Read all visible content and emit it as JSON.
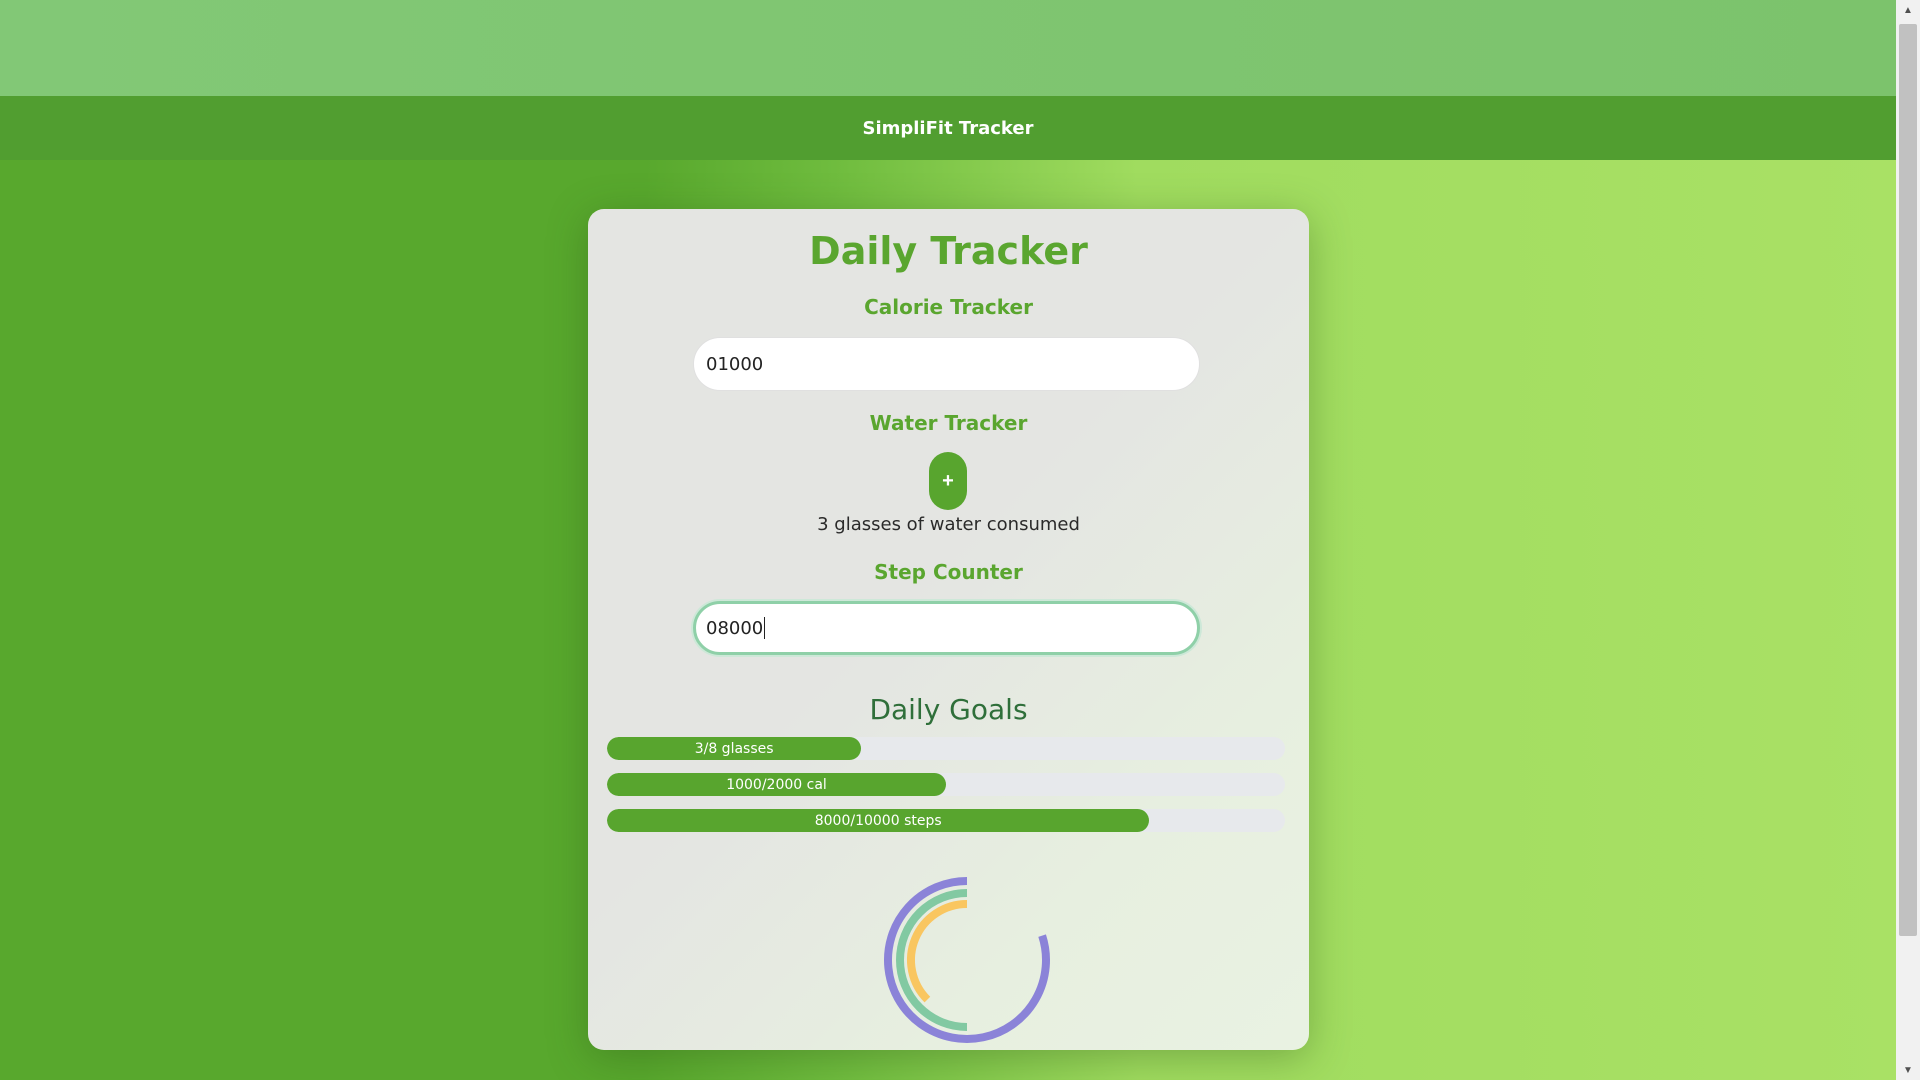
{
  "header": {
    "brand": "SimpliFit Tracker"
  },
  "card": {
    "title": "Daily Tracker",
    "calorie": {
      "title": "Calorie Tracker",
      "value": "01000"
    },
    "water": {
      "title": "Water Tracker",
      "button_label": "+",
      "status": "3 glasses of water consumed"
    },
    "steps": {
      "title": "Step Counter",
      "value": "08000"
    }
  },
  "goals": {
    "title": "Daily Goals",
    "items": [
      {
        "label": "3/8 glasses",
        "fraction": 0.375
      },
      {
        "label": "1000/2000 cal",
        "fraction": 0.5
      },
      {
        "label": "8000/10000 steps",
        "fraction": 0.8
      }
    ]
  },
  "chart_data": {
    "type": "radial-progress",
    "series": [
      {
        "value": 0.8,
        "color": "#8b83d8"
      },
      {
        "value": 0.5,
        "color": "#82c9a2"
      },
      {
        "value": 0.375,
        "color": "#f9c660"
      }
    ]
  },
  "colors": {
    "accent": "#58a52e",
    "nav": "#519e30",
    "title": "#5aa62f"
  },
  "icons": {
    "scroll_up": "scroll-up-arrow-icon",
    "scroll_down": "scroll-down-arrow-icon"
  }
}
